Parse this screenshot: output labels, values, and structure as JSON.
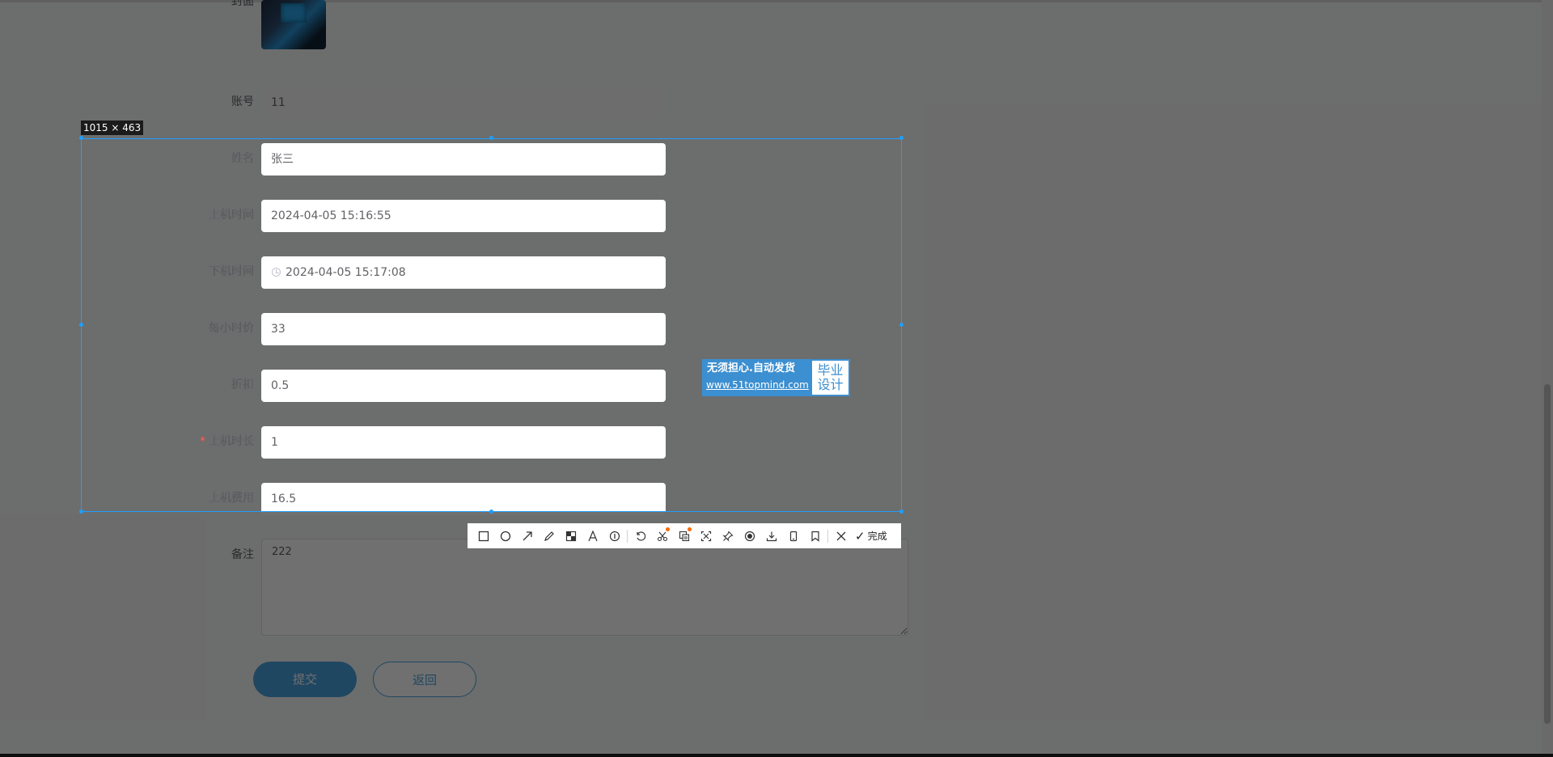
{
  "form": {
    "cover_label": "封面",
    "fields": [
      {
        "label": "账号",
        "value": "11"
      },
      {
        "label": "姓名",
        "value": "张三"
      },
      {
        "label": "上机时间",
        "value": "2024-04-05 15:16:55"
      },
      {
        "label": "下机时间",
        "value": "2024-04-05 15:17:08"
      },
      {
        "label": "每小时价",
        "value": "33"
      },
      {
        "label": "折扣",
        "value": "0.5"
      },
      {
        "label": "上机时长",
        "value": "1",
        "required_mark": "*"
      },
      {
        "label": "上机费用",
        "value": "16.5"
      }
    ],
    "remark_label": "备注",
    "remark_value": "222",
    "submit_label": "提交",
    "back_label": "返回"
  },
  "capture": {
    "size_text": "1015 × 463",
    "watermark_line1": "无须担心.自动发货",
    "watermark_line2": "www.51topmind.com",
    "watermark_side1": "毕业",
    "watermark_side2": "设计",
    "done_label": "完成",
    "accent": "#1e9fff"
  },
  "toolbar": {
    "tools": [
      "rectangle-icon",
      "ellipse-icon",
      "arrow-icon",
      "pen-icon",
      "mosaic-icon",
      "text-icon",
      "number-icon",
      "undo-icon",
      "cutout-icon",
      "ocr-icon",
      "scroll-capture-icon",
      "pin-icon",
      "record-icon",
      "download-icon",
      "phone-icon",
      "bookmark-icon",
      "close-icon"
    ]
  }
}
